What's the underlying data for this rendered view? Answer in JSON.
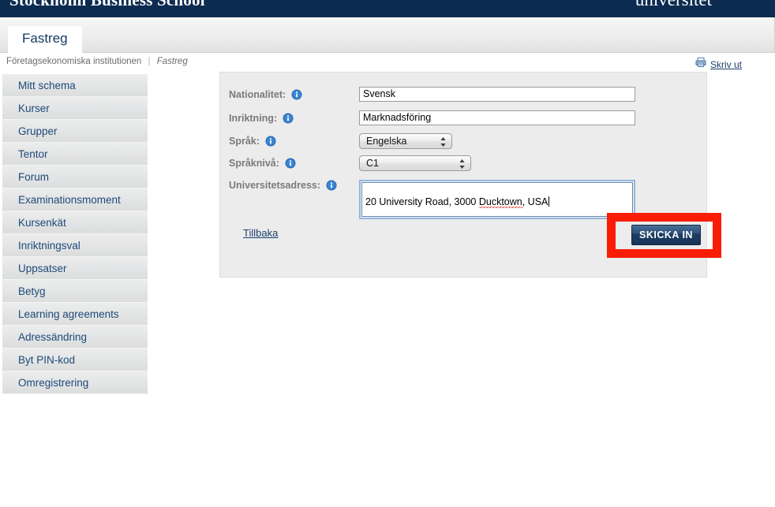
{
  "banner": {
    "brand_left": "Stockholm Business School",
    "brand_right": "universitet"
  },
  "tabs": [
    {
      "label": "Fastreg",
      "active": true
    }
  ],
  "breadcrumb": {
    "parent": "Företagsekonomiska institutionen",
    "separator": "|",
    "current": "Fastreg"
  },
  "print": {
    "icon": "printer-icon",
    "label": "Skriv ut"
  },
  "sidebar": {
    "items": [
      {
        "label": "Mitt schema"
      },
      {
        "label": "Kurser"
      },
      {
        "label": "Grupper"
      },
      {
        "label": "Tentor"
      },
      {
        "label": "Forum"
      },
      {
        "label": "Examinationsmoment"
      },
      {
        "label": "Kursenkät"
      },
      {
        "label": "Inriktningsval"
      },
      {
        "label": "Uppsatser"
      },
      {
        "label": "Betyg"
      },
      {
        "label": "Learning agreements"
      },
      {
        "label": "Adressändring"
      },
      {
        "label": "Byt PIN-kod"
      },
      {
        "label": "Omregistrering"
      }
    ]
  },
  "form": {
    "fields": [
      {
        "label": "Nationalitet:",
        "info_icon": "info-icon",
        "type": "text",
        "value": "Svensk"
      },
      {
        "label": "Inriktning:",
        "info_icon": "info-icon",
        "type": "text",
        "value": "Marknadsföring"
      },
      {
        "label": "Språk:",
        "info_icon": "info-icon",
        "type": "select",
        "value": "Engelska"
      },
      {
        "label": "Språknivå:",
        "info_icon": "info-icon",
        "type": "select",
        "value": "C1"
      },
      {
        "label": "Universitetsadress:",
        "info_icon": "info-icon",
        "type": "textarea",
        "value": "20 University Road, 3000 Ducktown, USA",
        "value_before_misspelling": "20 University Road, 3000 ",
        "misspelled_word": "Ducktown",
        "value_after_misspelling": ", USA"
      }
    ],
    "back_link": "Tillbaka",
    "submit_label": "SKICKA IN"
  },
  "annotation": {
    "highlight_color": "#f91d05",
    "target": "submit-button"
  },
  "colors": {
    "banner_navy": "#0b2b50",
    "sidebar_link": "#1d4a78",
    "button_navy": "#1d3e63",
    "highlight_red": "#f91d05"
  }
}
